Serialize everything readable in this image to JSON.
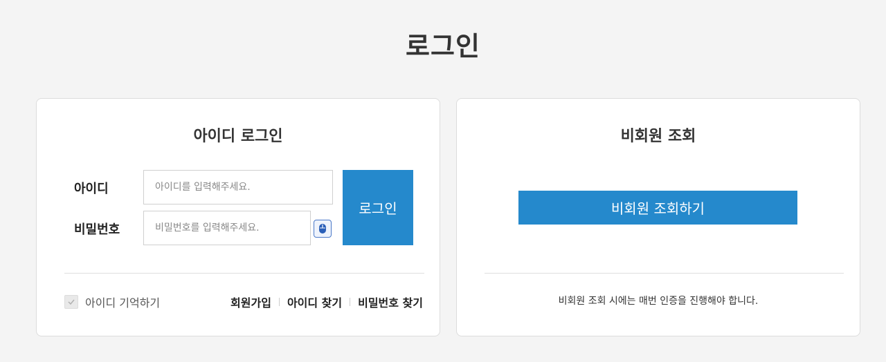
{
  "page": {
    "title": "로그인"
  },
  "member_login": {
    "title": "아이디 로그인",
    "id_label": "아이디",
    "id_placeholder": "아이디를 입력해주세요.",
    "password_label": "비밀번호",
    "password_placeholder": "비밀번호를 입력해주세요.",
    "keypad_icon": "mouse-keypad-icon",
    "login_button": "로그인",
    "remember_label": "아이디 기억하기",
    "links": {
      "signup": "회원가입",
      "find_id": "아이디 찾기",
      "find_password": "비밀번호 찾기"
    }
  },
  "guest_lookup": {
    "title": "비회원 조회",
    "button": "비회원 조회하기",
    "notice": "비회원 조회 시에는 매번 인증을 진행해야 합니다."
  },
  "colors": {
    "accent": "#2589cc",
    "background": "#f4f4f4"
  }
}
